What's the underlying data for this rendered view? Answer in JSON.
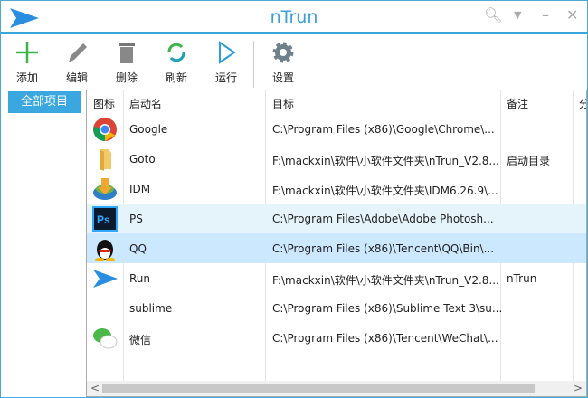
{
  "window": {
    "title": "nTrun"
  },
  "toolbar": {
    "add": "添加",
    "edit": "编辑",
    "delete": "删除",
    "refresh": "刷新",
    "run": "运行",
    "settings": "设置"
  },
  "sidebar": {
    "category": "全部项目"
  },
  "table": {
    "headers": [
      "图标",
      "启动名",
      "目标",
      "备注",
      "分"
    ],
    "rows": [
      {
        "icon": "chrome-icon",
        "name": "Google",
        "target": "C:\\Program Files (x86)\\Google\\Chrome\\...",
        "note": ""
      },
      {
        "icon": "folder-icon",
        "name": "Goto",
        "target": "F:\\mackxin\\软件\\小软件文件夹\\nTrun_V2.8...",
        "note": "启动目录"
      },
      {
        "icon": "idm-icon",
        "name": "IDM",
        "target": "F:\\mackxin\\软件\\小软件文件夹\\IDM6.26.9\\...",
        "note": ""
      },
      {
        "icon": "photoshop-icon",
        "name": "PS",
        "target": "C:\\Program Files\\Adobe\\Adobe Photosh...",
        "note": ""
      },
      {
        "icon": "qq-icon",
        "name": "QQ",
        "target": "C:\\Program Files (x86)\\Tencent\\QQ\\Bin\\...",
        "note": ""
      },
      {
        "icon": "run-icon",
        "name": "Run",
        "target": "F:\\mackxin\\软件\\小软件文件夹\\nTrun_V2.8...",
        "note": "nTrun"
      },
      {
        "icon": "blank-icon",
        "name": "sublime",
        "target": "C:\\Program Files (x86)\\Sublime Text 3\\su...",
        "note": ""
      },
      {
        "icon": "wechat-icon",
        "name": "微信",
        "target": "C:\\Program Files (x86)\\Tencent\\WeChat\\...",
        "note": ""
      }
    ]
  },
  "colors": {
    "accent": "#3aa7e0",
    "hover": "#e5f3fb",
    "selected": "#cce8ff"
  }
}
